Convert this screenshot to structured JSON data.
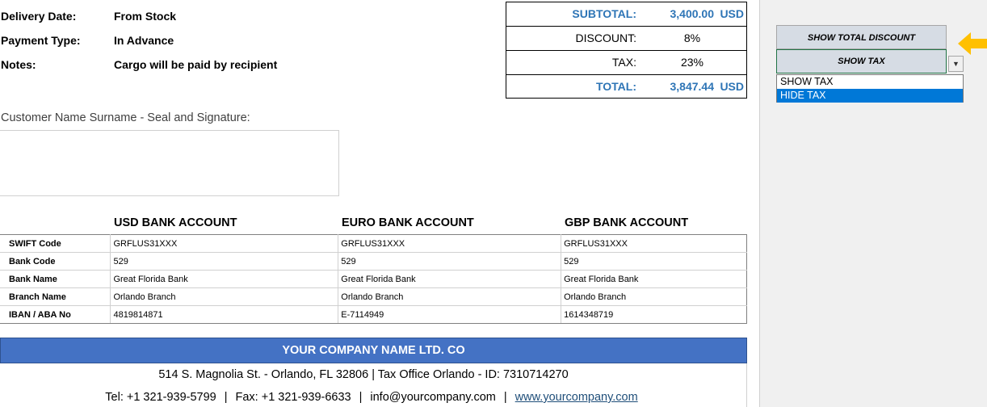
{
  "info": {
    "delivery_label": "Delivery Date:",
    "delivery_value": "From Stock",
    "payment_label": "Payment Type:",
    "payment_value": "In Advance",
    "notes_label": "Notes:",
    "notes_value": "Cargo will be paid by recipient"
  },
  "totals": {
    "subtotal_label": "SUBTOTAL:",
    "subtotal_value": "3,400.00",
    "subtotal_currency": "USD",
    "discount_label": "DISCOUNT:",
    "discount_value": "8%",
    "tax_label": "TAX:",
    "tax_value": "23%",
    "total_label": "TOTAL:",
    "total_value": "3,847.44",
    "total_currency": "USD"
  },
  "signature": {
    "label": "Customer Name Surname - Seal and Signature:"
  },
  "bank": {
    "headers": [
      "USD BANK ACCOUNT",
      "EURO BANK ACCOUNT",
      "GBP BANK ACCOUNT"
    ],
    "rows": [
      {
        "label": "SWIFT Code",
        "values": [
          "GRFLUS31XXX",
          "GRFLUS31XXX",
          "GRFLUS31XXX"
        ]
      },
      {
        "label": "Bank Code",
        "values": [
          "529",
          "529",
          "529"
        ]
      },
      {
        "label": "Bank Name",
        "values": [
          "Great Florida Bank",
          "Great Florida Bank",
          "Great Florida Bank"
        ]
      },
      {
        "label": "Branch Name",
        "values": [
          "Orlando Branch",
          "Orlando Branch",
          "Orlando Branch"
        ]
      },
      {
        "label": "IBAN / ABA No",
        "values": [
          "4819814871",
          "E-7114949",
          "1614348719"
        ]
      }
    ]
  },
  "footer": {
    "company": "YOUR COMPANY NAME LTD. CO",
    "address": "514 S. Magnolia St. - Orlando, FL 32806  |  Tax Office Orlando - ID: 7310714270",
    "tel": "Tel: +1 321-939-5799",
    "fax": "Fax: +1 321-939-6633",
    "email": "info@yourcompany.com",
    "website": "www.yourcompany.com",
    "separator": "|"
  },
  "controls": {
    "show_total_discount": "SHOW TOTAL DISCOUNT",
    "show_tax": "SHOW TAX",
    "dropdown_options": [
      "SHOW TAX",
      "HIDE TAX"
    ],
    "selected_option": "HIDE TAX"
  },
  "colors": {
    "accent_blue": "#2e75b6",
    "company_bar": "#4472c4",
    "arrow": "#ffc000",
    "dropdown_highlight": "#0078d7"
  },
  "icons": {
    "pointer_arrow": "arrow-left-icon",
    "dropdown": "chevron-down-icon"
  }
}
